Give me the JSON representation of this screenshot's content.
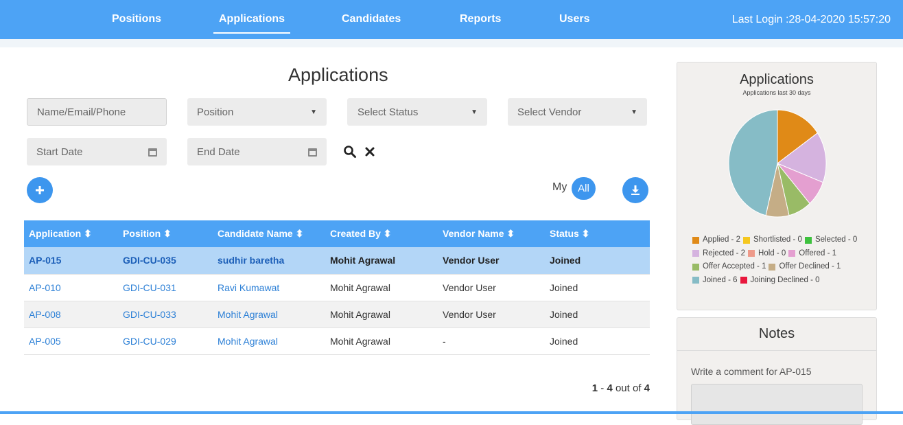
{
  "nav": {
    "items": [
      "Positions",
      "Applications",
      "Candidates",
      "Reports",
      "Users"
    ],
    "active": "Applications",
    "last_login": "Last Login :28-04-2020 15:57:20"
  },
  "page": {
    "title": "Applications"
  },
  "filters": {
    "search_placeholder": "Name/Email/Phone",
    "position": "Position",
    "status": "Select Status",
    "vendor": "Select Vendor",
    "start_date": "Start Date",
    "end_date": "End Date"
  },
  "toggle": {
    "my": "My",
    "all": "All"
  },
  "table": {
    "headers": [
      "Application ⬍",
      "Position ⬍",
      "Candidate Name ⬍",
      "Created By ⬍",
      "Vendor Name ⬍",
      "Status ⬍"
    ],
    "rows": [
      [
        "AP-015",
        "GDI-CU-035",
        "sudhir baretha",
        "Mohit Agrawal",
        "Vendor User",
        "Joined"
      ],
      [
        "AP-010",
        "GDI-CU-031",
        "Ravi Kumawat",
        "Mohit Agrawal",
        "Vendor User",
        "Joined"
      ],
      [
        "AP-008",
        "GDI-CU-033",
        "Mohit Agrawal",
        "Mohit Agrawal",
        "Vendor User",
        "Joined"
      ],
      [
        "AP-005",
        "GDI-CU-029",
        "Mohit Agrawal",
        "Mohit Agrawal",
        "-",
        "Joined"
      ]
    ]
  },
  "pagination": {
    "start": "1",
    "end": "4",
    "mid": "out of",
    "total": "4"
  },
  "chart_panel": {
    "title": "Applications",
    "subtitle": "Applications last 30 days"
  },
  "chart_data": {
    "type": "pie",
    "title": "Applications",
    "subtitle": "Applications last 30 days",
    "slices": [
      {
        "label": "Applied",
        "value": 2,
        "color": "#e08a17"
      },
      {
        "label": "Shortlisted",
        "value": 0,
        "color": "#f5c71e"
      },
      {
        "label": "Selected",
        "value": 0,
        "color": "#3ec13e"
      },
      {
        "label": "Rejected",
        "value": 2,
        "color": "#d5b3df"
      },
      {
        "label": "Hold",
        "value": 0,
        "color": "#ee9a8a"
      },
      {
        "label": "Offered",
        "value": 1,
        "color": "#e49fd0"
      },
      {
        "label": "Offer Accepted",
        "value": 1,
        "color": "#99bb66"
      },
      {
        "label": "Offer Declined",
        "value": 1,
        "color": "#c5ad86"
      },
      {
        "label": "Joined",
        "value": 6,
        "color": "#86bcc6"
      },
      {
        "label": "Joining Declined",
        "value": 0,
        "color": "#e8173d"
      }
    ],
    "legend_text": [
      "Applied - 2",
      "Shortlisted - 0",
      "Selected - 0",
      "Rejected - 2",
      "Hold - 0",
      "Offered - 1",
      "Offer Accepted - 1",
      "Offer Declined - 1",
      "Joined - 6",
      "Joining Declined - 0"
    ],
    "legend_placement": "bottom"
  },
  "notes": {
    "title": "Notes",
    "label": "Write a comment for AP-015"
  },
  "colors": {
    "primary": "#4da3f5",
    "button": "#3d96ee",
    "selected_row": "#b3d6f7",
    "link": "#2b7fd6"
  }
}
